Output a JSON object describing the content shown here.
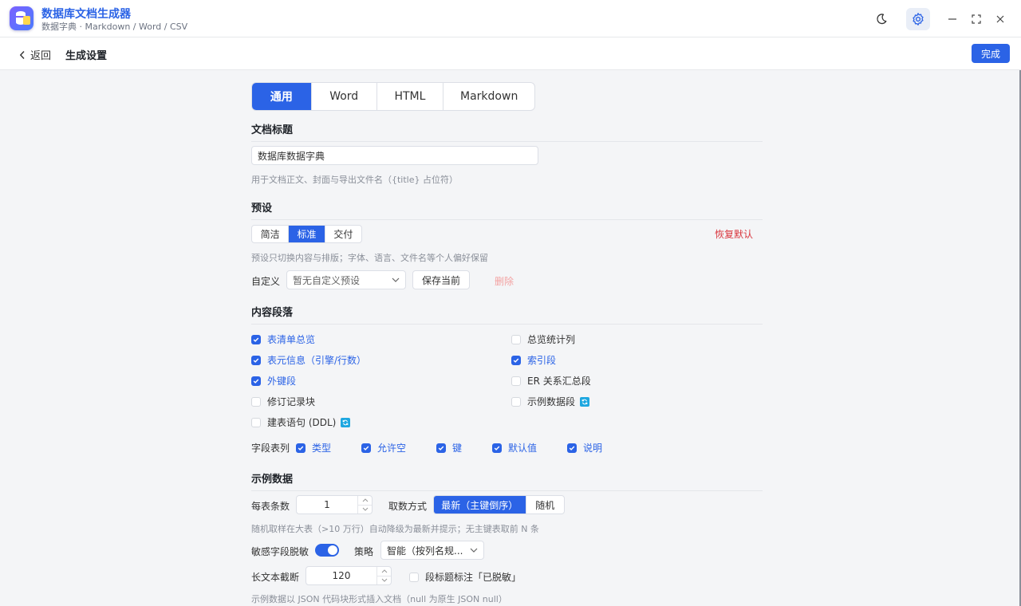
{
  "app": {
    "title": "数据库文档生成器",
    "subtitle": "数据字典 · Markdown / Word / CSV"
  },
  "subbar": {
    "back_label": "返回",
    "page_title": "生成设置",
    "done_label": "完成"
  },
  "tabs": [
    {
      "label": "通用",
      "active": true
    },
    {
      "label": "Word",
      "active": false
    },
    {
      "label": "HTML",
      "active": false
    },
    {
      "label": "Markdown",
      "active": false
    }
  ],
  "doc_title": {
    "heading": "文档标题",
    "value": "数据库数据字典",
    "hint": "用于文档正文、封面与导出文件名（{title} 占位符）"
  },
  "preset": {
    "heading": "预设",
    "options": [
      {
        "label": "简洁",
        "active": false
      },
      {
        "label": "标准",
        "active": true
      },
      {
        "label": "交付",
        "active": false
      }
    ],
    "reset_label": "恢复默认",
    "hint": "预设只切换内容与排版；字体、语言、文件名等个人偏好保留",
    "custom_label": "自定义",
    "custom_placeholder": "暂无自定义预设",
    "save_label": "保存当前",
    "delete_label": "删除"
  },
  "sections": {
    "heading": "内容段落",
    "left": [
      {
        "label": "表清单总览",
        "checked": true,
        "sync": false
      },
      {
        "label": "表元信息（引擎/行数）",
        "checked": true,
        "sync": false
      },
      {
        "label": "外键段",
        "checked": true,
        "sync": false
      },
      {
        "label": "修订记录块",
        "checked": false,
        "sync": false
      },
      {
        "label": "建表语句 (DDL)",
        "checked": false,
        "sync": true
      }
    ],
    "right": [
      {
        "label": "总览统计列",
        "checked": false,
        "sync": false
      },
      {
        "label": "索引段",
        "checked": true,
        "sync": false
      },
      {
        "label": "ER 关系汇总段",
        "checked": false,
        "sync": false
      },
      {
        "label": "示例数据段",
        "checked": false,
        "sync": true
      }
    ],
    "columns_label": "字段表列",
    "columns": [
      {
        "label": "类型",
        "checked": true
      },
      {
        "label": "允许空",
        "checked": true
      },
      {
        "label": "键",
        "checked": true
      },
      {
        "label": "默认值",
        "checked": true
      },
      {
        "label": "说明",
        "checked": true
      }
    ]
  },
  "sample": {
    "heading": "示例数据",
    "rows_label": "每表条数",
    "rows_value": "1",
    "mode_label": "取数方式",
    "mode_options": [
      {
        "label": "最新（主键倒序）",
        "active": true
      },
      {
        "label": "随机",
        "active": false
      }
    ],
    "hint1": "随机取样在大表（>10 万行）自动降级为最新并提示；无主键表取前 N 条",
    "mask_label": "敏感字段脱敏",
    "mask_on": true,
    "strategy_label": "策略",
    "strategy_value": "智能（按列名规...",
    "truncate_label": "长文本截断",
    "truncate_value": "120",
    "mark_label": "段标题标注「已脱敏」",
    "mark_checked": false,
    "hint2": "示例数据以 JSON 代码块形式插入文档（null 为原生 JSON null）"
  },
  "colors": {
    "accent": "#2b63e6",
    "danger": "#d9363e",
    "sync": "#1ea7e0"
  }
}
